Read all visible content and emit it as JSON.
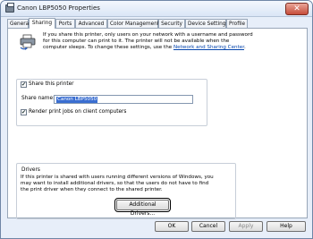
{
  "window": {
    "title": "Canon LBP5050 Properties",
    "close_glyph": "✕"
  },
  "tabs": [
    "General",
    "Sharing",
    "Ports",
    "Advanced",
    "Color Management",
    "Security",
    "Device Settings",
    "Profile"
  ],
  "intro": {
    "text": "If you share this printer, only users on your network with a username and password for this computer can print to it. The printer will not be available when the computer sleeps. To change these settings, use the ",
    "link": "Network and Sharing Center",
    "end": "."
  },
  "share": {
    "share_printer_label": "Share this printer",
    "share_printer_checked": true,
    "share_name_label": "Share name:",
    "share_name_value": "Canon LBP5050",
    "render_label": "Render print jobs on client computers",
    "render_checked": true
  },
  "drivers": {
    "heading": "Drivers",
    "text": "If this printer is shared with users running different versions of Windows, you may want to install additional drivers, so that the users do not have to find the print driver when they connect to the shared printer.",
    "additional_button": "Additional Drivers..."
  },
  "buttons": {
    "ok": "OK",
    "cancel": "Cancel",
    "apply": "Apply",
    "help": "Help"
  },
  "icons": {
    "app": "printer-icon",
    "share": "shared-printer-icon"
  }
}
